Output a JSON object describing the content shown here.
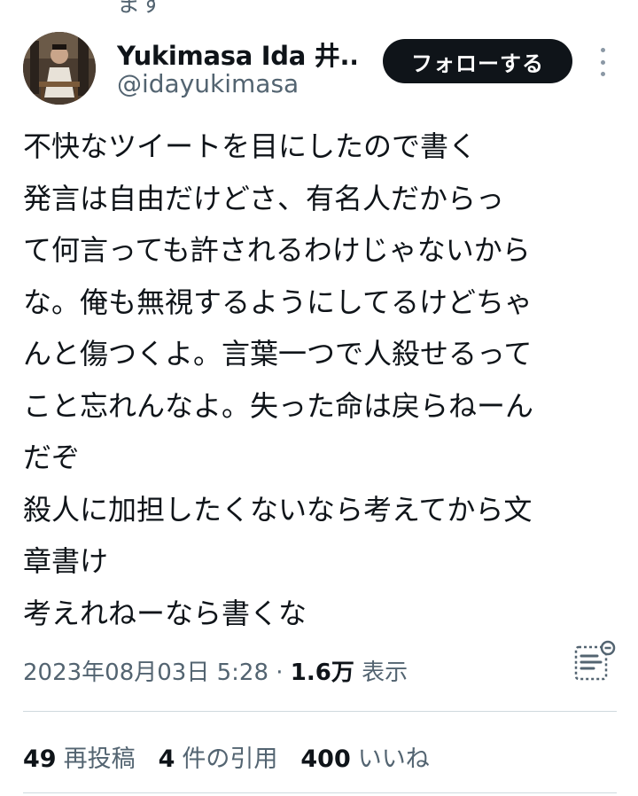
{
  "top_fragment": "ます",
  "author": {
    "display_name": "Yukimasa Ida 井...",
    "handle": "@idayukimasa"
  },
  "follow_button_label": "フォローする",
  "more_icon": "more-vertical-icon",
  "tweet_lines": [
    "不快なツイートを目にしたので書く",
    "発言は自由だけどさ、有名人だからっ",
    "て何言っても許されるわけじゃないから",
    "な。俺も無視するようにしてるけどちゃ",
    "んと傷つくよ。言葉一つで人殺せるって",
    "こと忘れんなよ。失った命は戻らねーん",
    "だぞ",
    "殺人に加担したくないなら考えてから文",
    "章書け",
    "考えれねーなら書くな"
  ],
  "meta": {
    "timestamp": "2023年08月03日 5:28",
    "separator": " · ",
    "views_count": "1.6万",
    "views_label": " 表示"
  },
  "analytics_icon": "analytics-icon",
  "stats": {
    "reposts_count": "49",
    "reposts_label": "再投稿",
    "quotes_count": "4",
    "quotes_label": "件の引用",
    "likes_count": "400",
    "likes_label": "いいね"
  },
  "colors": {
    "text": "#0f1419",
    "secondary": "#536471",
    "button_bg": "#0f1419",
    "divider": "#cfd9de"
  }
}
